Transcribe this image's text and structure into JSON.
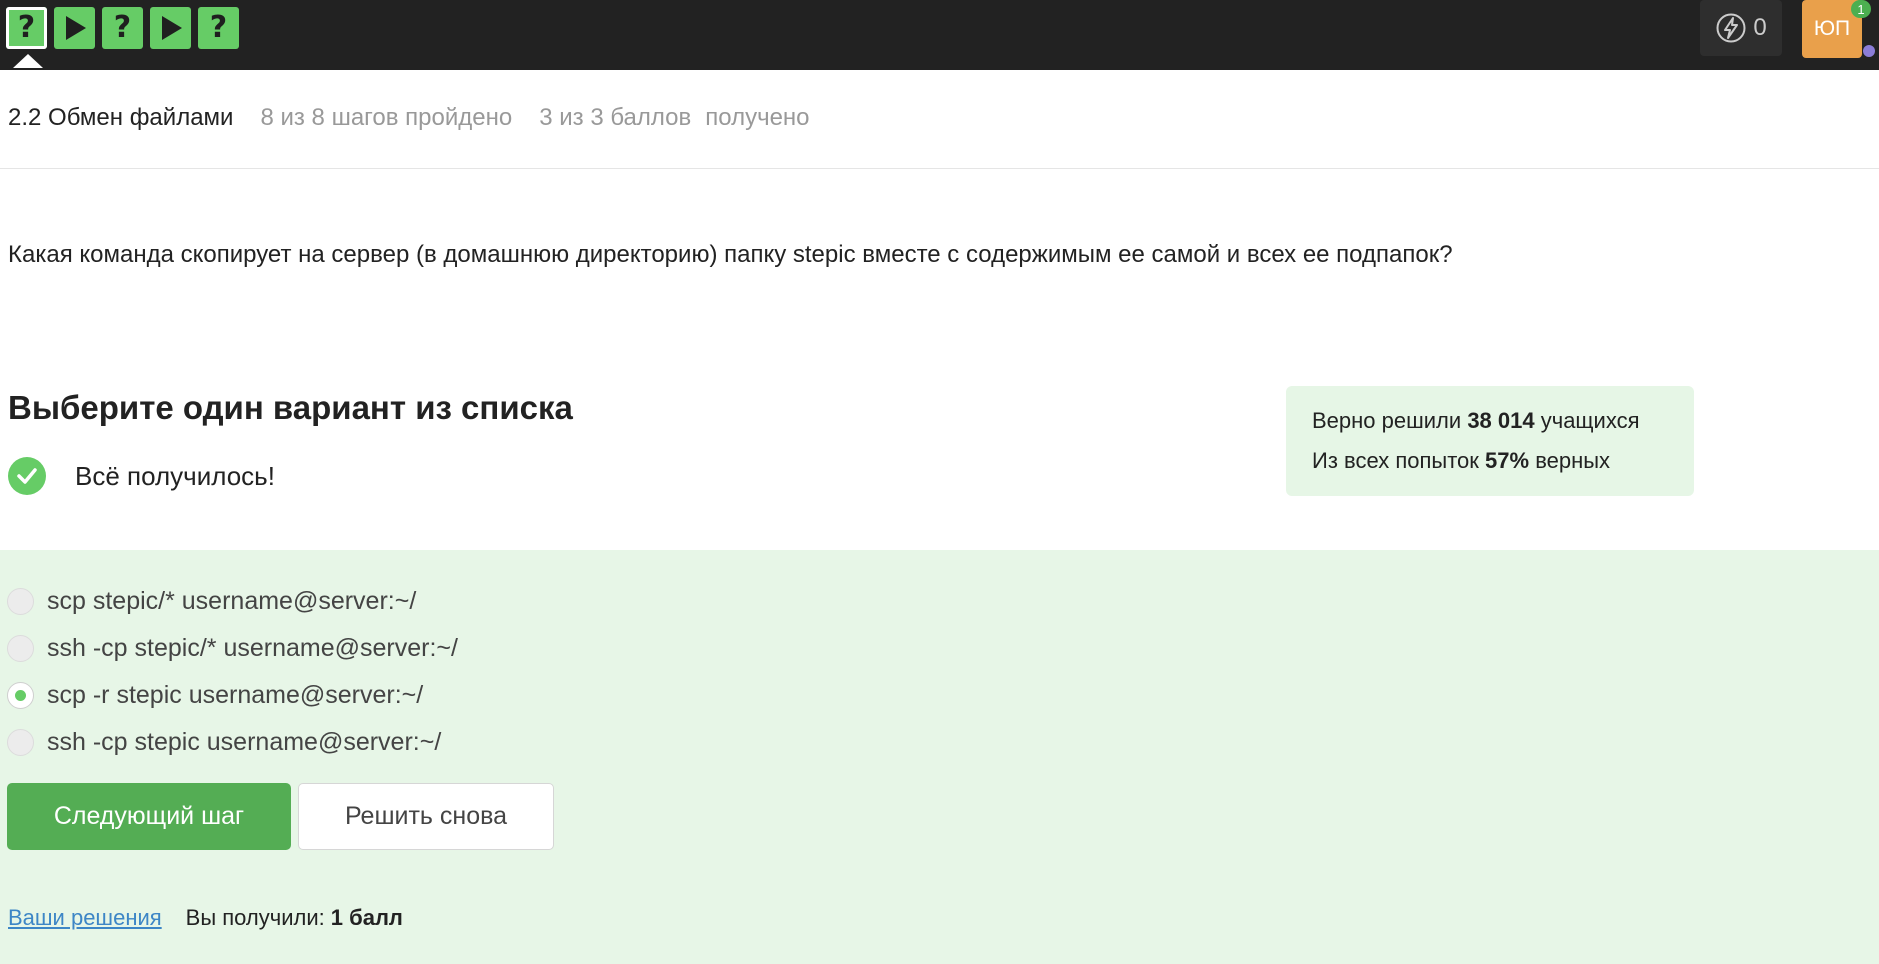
{
  "steps": [
    {
      "type": "question",
      "glyph": "?",
      "active": true
    },
    {
      "type": "code",
      "glyph": "play",
      "active": false
    },
    {
      "type": "question",
      "glyph": "?",
      "active": false
    },
    {
      "type": "code",
      "glyph": "play",
      "active": false
    },
    {
      "type": "question",
      "glyph": "?",
      "active": false
    }
  ],
  "header": {
    "energy_count": "0",
    "avatar_initials": "ЮП",
    "notification_count": "1"
  },
  "lesson": {
    "title": "2.2 Обмен файлами",
    "steps_progress": "8 из 8 шагов пройдено",
    "points_progress": "3 из 3 баллов",
    "points_suffix": "получено"
  },
  "question": {
    "text": "Какая команда скопирует на сервер (в домашнюю директорию) папку stepic вместе с содержимым ее самой и всех ее подпапок?"
  },
  "quiz": {
    "title": "Выберите один вариант из списка",
    "success_message": "Всё получилось!",
    "options": [
      {
        "label": "scp stepic/* username@server:~/",
        "selected": false
      },
      {
        "label": "ssh -cp stepic/* username@server:~/",
        "selected": false
      },
      {
        "label": "scp -r stepic username@server:~/",
        "selected": true
      },
      {
        "label": "ssh -cp stepic username@server:~/",
        "selected": false
      }
    ],
    "next_button": "Следующий шаг",
    "retry_button": "Решить снова",
    "solutions_link": "Ваши решения",
    "score_label": "Вы получили:",
    "score_value": "1 балл"
  },
  "stats": {
    "solved_prefix": "Верно решили",
    "solved_count": "38 014",
    "solved_suffix": "учащихся",
    "attempts_prefix": "Из всех попыток",
    "attempts_percent": "57%",
    "attempts_suffix": "верных"
  },
  "colors": {
    "topbar": "#222222",
    "step_green": "#66cc66",
    "button_green": "#54ad54",
    "answer_bg": "#e7f6e7",
    "stats_bg": "#e6f6e6",
    "avatar": "#e9a04b",
    "link": "#3d86c6"
  },
  "icons": {
    "question_step": "question-mark-icon",
    "code_step": "play-icon",
    "energy": "lightning-icon",
    "success": "checkmark-icon"
  }
}
